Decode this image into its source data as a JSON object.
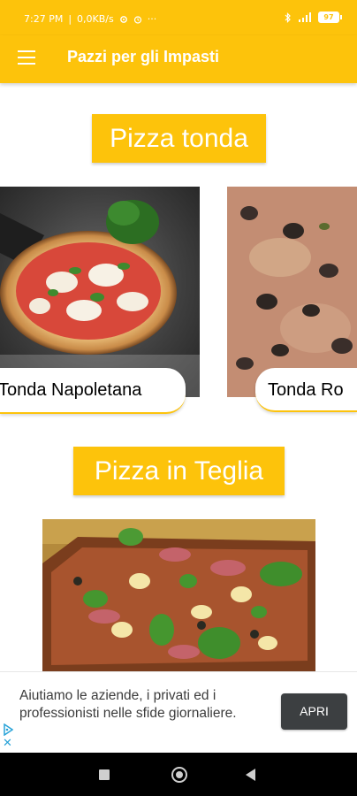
{
  "status_bar": {
    "time": "7:27 PM",
    "network_speed": "0,0KB/s",
    "more": "···",
    "battery": "97"
  },
  "app_bar": {
    "title": "Pazzi per gli Impasti",
    "menu_icon": "menu-icon"
  },
  "sections": [
    {
      "title": "Pizza tonda",
      "cards": [
        {
          "label": "Tonda Napoletana",
          "image": "margherita-pizza-image"
        },
        {
          "label": "Tonda Ro",
          "image": "roman-pizza-image"
        }
      ]
    },
    {
      "title": "Pizza in Teglia",
      "cards": [
        {
          "label": "",
          "image": "pan-pizza-image"
        }
      ]
    }
  ],
  "ad": {
    "text": "Aiutiamo le aziende, i privati ed i professionisti nelle sfide giornaliere.",
    "button_label": "APRI",
    "close": "✕"
  },
  "colors": {
    "primary": "#FDC30B",
    "ad_button": "#3c3f41",
    "adchoices": "#29a3d8"
  }
}
